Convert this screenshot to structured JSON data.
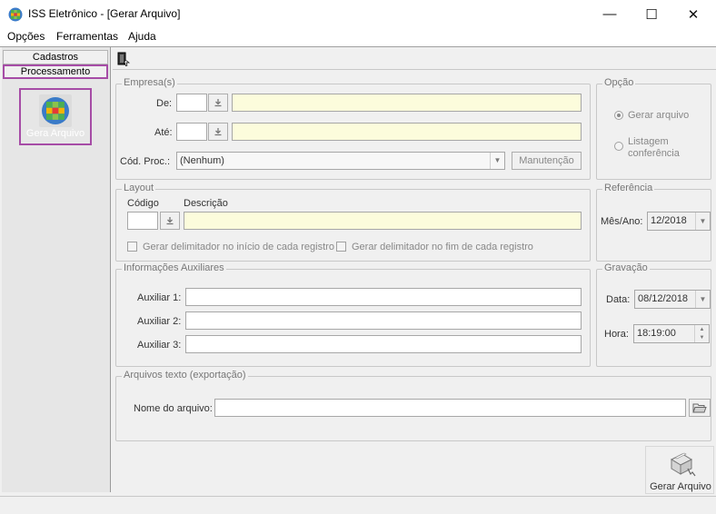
{
  "window": {
    "title": "ISS Eletrônico - [Gerar Arquivo]",
    "minimize": "—",
    "maximize": "☐",
    "close": "✕"
  },
  "menu": [
    "Opções",
    "Ferramentas",
    "Ajuda"
  ],
  "sidebar": {
    "items": [
      {
        "label": "Cadastros"
      },
      {
        "label": "Processamento",
        "selected": true
      }
    ],
    "tile": {
      "label": "Gera Arquivo"
    }
  },
  "empresas": {
    "legend": "Empresa(s)",
    "de_label": "De:",
    "ate_label": "Até:",
    "cod_proc_label": "Cód. Proc.:",
    "cod_proc_value": "(Nenhum)",
    "manutencao_label": "Manutenção",
    "de_value": "",
    "ate_value": ""
  },
  "opcao": {
    "legend": "Opção",
    "options": [
      {
        "label": "Gerar arquivo",
        "checked": true
      },
      {
        "label": "Listagem\nconferência",
        "checked": false
      }
    ]
  },
  "layout": {
    "legend": "Layout",
    "codigo_label": "Código",
    "descricao_label": "Descrição",
    "check_inicio": "Gerar delimitador no início de cada registro",
    "check_fim": "Gerar delimitador no fim de cada registro"
  },
  "referencia": {
    "legend": "Referência",
    "mes_ano_label": "Mês/Ano:",
    "mes_ano_value": "12/2018"
  },
  "auxiliares": {
    "legend": "Informações Auxiliares",
    "labels": [
      "Auxiliar 1:",
      "Auxiliar 2:",
      "Auxiliar 3:"
    ]
  },
  "gravacao": {
    "legend": "Gravação",
    "data_label": "Data:",
    "data_value": "08/12/2018",
    "hora_label": "Hora:",
    "hora_value": "18:19:00"
  },
  "arquivos": {
    "legend": "Arquivos texto (exportação)",
    "nome_label": "Nome do arquivo:",
    "nome_value": ""
  },
  "actions": {
    "gerar_label": "Gerar Arquivo"
  },
  "colors": {
    "highlight": "#a64ca6",
    "field_yellow": "#fcfcdc"
  }
}
